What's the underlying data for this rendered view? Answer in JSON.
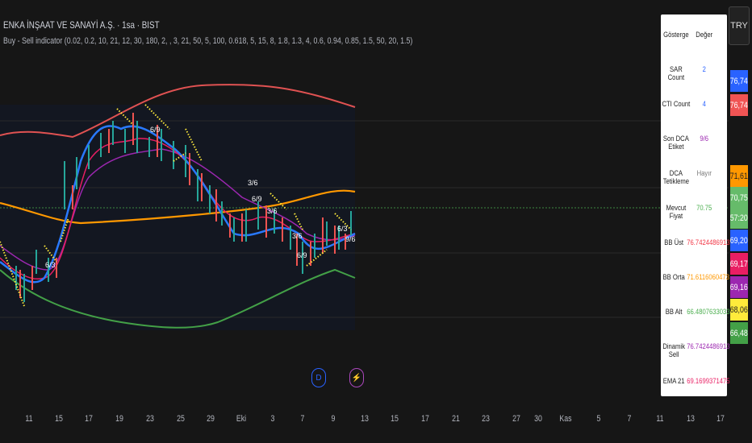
{
  "header": {
    "title": "ENKA İNŞAAT VE SANAYİ A.Ş. · 1sa · BIST",
    "indicator": "Buy - Sell indicator (0.02, 0.2, 10, 21, 12, 30, 180, 2, , 3, 21, 50, 5, 100, 0.618, 5, 15, 8, 1.8, 1.3, 4, 0.6, 0.94, 0.85, 1.5, 50, 20, 1.5)"
  },
  "table": {
    "header": {
      "key": "Gösterge",
      "value": "Değer"
    },
    "rows": [
      {
        "key": "SAR Count",
        "value": "2",
        "color": "#2962ff"
      },
      {
        "key": "CTI Count",
        "value": "4",
        "color": "#2962ff"
      },
      {
        "key": "Son DCA Etiket",
        "value": "9/6",
        "color": "#9c27b0"
      },
      {
        "key": "DCA Tetikleme",
        "value": "Hayır",
        "color": "#777777"
      },
      {
        "key": "Mevcut Fiyat",
        "value": "70.75",
        "color": "#4caf50"
      },
      {
        "key": "BB Üst",
        "value": "76.7424486913",
        "color": "#f23645"
      },
      {
        "key": "BB Orta",
        "value": "71.6116060473",
        "color": "#ff9800"
      },
      {
        "key": "BB Alt",
        "value": "66.4807633033",
        "color": "#4caf50"
      },
      {
        "key": "Dinamik Sell",
        "value": "76.7424486913",
        "color": "#9c27b0"
      },
      {
        "key": "EMA 21",
        "value": "69.1699371475",
        "color": "#e91e63"
      }
    ]
  },
  "price_axis": {
    "currency": "TRY",
    "labels": [
      {
        "value": "76,74",
        "color": "#2962ff"
      },
      {
        "value": "76,74",
        "color": "#f05454"
      },
      {
        "value": "71,61",
        "color": "#ff9800"
      },
      {
        "value": "70,75",
        "color": "#66bb6a"
      },
      {
        "value": "57:20",
        "color": "#66bb6a"
      },
      {
        "value": "69,20",
        "color": "#2962ff"
      },
      {
        "value": "69,17",
        "color": "#e91e63"
      },
      {
        "value": "69,16",
        "color": "#9c27b0"
      },
      {
        "value": "68,06",
        "color": "#ffeb3b"
      },
      {
        "value": "66,48",
        "color": "#43a047"
      }
    ]
  },
  "time_axis": [
    "11",
    "15",
    "17",
    "19",
    "23",
    "25",
    "29",
    "Eki",
    "3",
    "7",
    "9",
    "13",
    "15",
    "17",
    "21",
    "23",
    "27",
    "30",
    "Kas",
    "5",
    "7",
    "11",
    "13",
    "17"
  ],
  "dca_labels": [
    "6/3",
    "6/9",
    "3/6",
    "6/9",
    "3/6",
    "3/6",
    "6/9",
    "6/3",
    "9/6"
  ],
  "events": [
    {
      "icon": "dividend-icon",
      "text": "D",
      "color": "#2962ff"
    },
    {
      "icon": "lightning-icon",
      "text": "⚡",
      "color": "#ab47bc"
    }
  ]
}
